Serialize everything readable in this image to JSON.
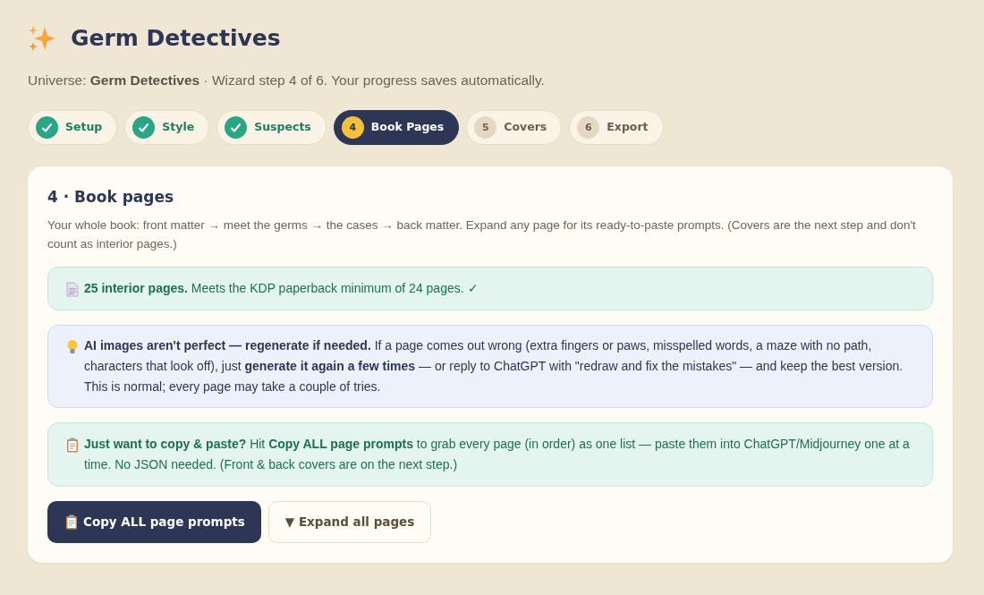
{
  "header": {
    "title": "Germ Detectives",
    "subtitle": "Universe: **Germ Detectives** · Wizard step 4 of 6. Your progress saves automatically."
  },
  "steps": [
    {
      "label": "Setup",
      "kind": "done",
      "selected": false
    },
    {
      "label": "Style",
      "kind": "done",
      "selected": false
    },
    {
      "label": "Suspects",
      "kind": "done",
      "selected": false
    },
    {
      "number": "4",
      "label": "Book Pages",
      "kind": "pending",
      "selected": true
    },
    {
      "number": "5",
      "label": "Covers",
      "kind": "pending",
      "selected": false
    },
    {
      "number": "6",
      "label": "Export",
      "kind": "pending",
      "selected": false
    }
  ],
  "panel": {
    "title": "4 · Book pages",
    "description": "Your whole book: front matter → meet the germs → the cases → back matter. Expand any page for its ready-to-paste prompts. (Covers are the next step and don't count as interior pages.)",
    "notices": [
      {
        "kind": "success",
        "text": "**25 interior pages.** Meets the KDP paperback minimum of 24 pages. ✓"
      },
      {
        "kind": "tip",
        "text": "**AI images aren't perfect — regenerate if needed.** If a page comes out wrong (extra fingers or paws, misspelled words, a maze with no path, characters that look off), just **generate it again a few times** — or reply to ChatGPT with \"redraw and fix the mistakes\" — and keep the best version. This is normal; every page may take a couple of tries."
      },
      {
        "kind": "success",
        "text": "**Just want to copy & paste?** Hit **Copy ALL page prompts** to grab every page (in order) as one list — paste them into ChatGPT/Midjourney one at a time. No JSON needed. (Front & back covers are on the next step.)"
      }
    ],
    "buttons": [
      {
        "kind": "primary",
        "label": "Copy ALL page prompts"
      },
      {
        "kind": "outline",
        "label": "▼ Expand all pages"
      }
    ]
  }
}
